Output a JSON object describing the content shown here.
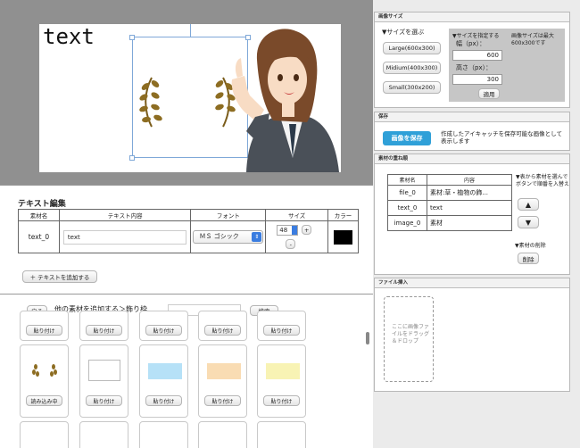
{
  "canvas": {
    "text": "text"
  },
  "text_editor": {
    "title": "テキスト編集",
    "columns": [
      "素材名",
      "テキスト内容",
      "フォント",
      "サイズ",
      "カラー"
    ],
    "row": {
      "name": "text_0",
      "content": "text",
      "font": "ＭＳ ゴシック",
      "size": "48",
      "plus": "+",
      "minus": "-"
    },
    "add_button": "＋ テキストを追加する"
  },
  "material_browser": {
    "back": "戻る",
    "path": "他の素材を追加する＞飾り枠",
    "search_placeholder": "",
    "search_button": "検索",
    "paste_label": "貼り付け",
    "loading_label": "読み込み中"
  },
  "image_size": {
    "header": "画像サイズ",
    "choose_label": "▼サイズを選ぶ",
    "options": [
      "Large(600x300)",
      "Midium(400x300)",
      "Small(300x200)"
    ],
    "specify_label": "▼サイズを指定する",
    "width_label": "幅（px）：",
    "width_value": "600",
    "height_label": "高さ（px）：",
    "height_value": "300",
    "apply": "適用",
    "note": "画像サイズは最大600x300です"
  },
  "save": {
    "header": "保存",
    "button": "画像を保存",
    "desc": "作成したアイキャッチを保存可能な画像として表示します"
  },
  "layers": {
    "header": "素材の重ね順",
    "columns": [
      "素材名",
      "内容"
    ],
    "rows": [
      {
        "name": "file_0",
        "content": "素材:草・植物の飾..."
      },
      {
        "name": "text_0",
        "content": "text"
      },
      {
        "name": "image_0",
        "content": "素材"
      }
    ],
    "order_help": "▼表から素材を選んでボタンで順番を入替え",
    "up": "▲",
    "down": "▼",
    "delete_label": "▼素材の削除",
    "delete_button": "削除"
  },
  "file_insert": {
    "header": "ファイル挿入",
    "drop_text": "ここに画像ファイルをドラッグ＆ドロップ"
  },
  "colors": {
    "accent": "#2fa0d8",
    "text_color_swatch": "#000000"
  }
}
